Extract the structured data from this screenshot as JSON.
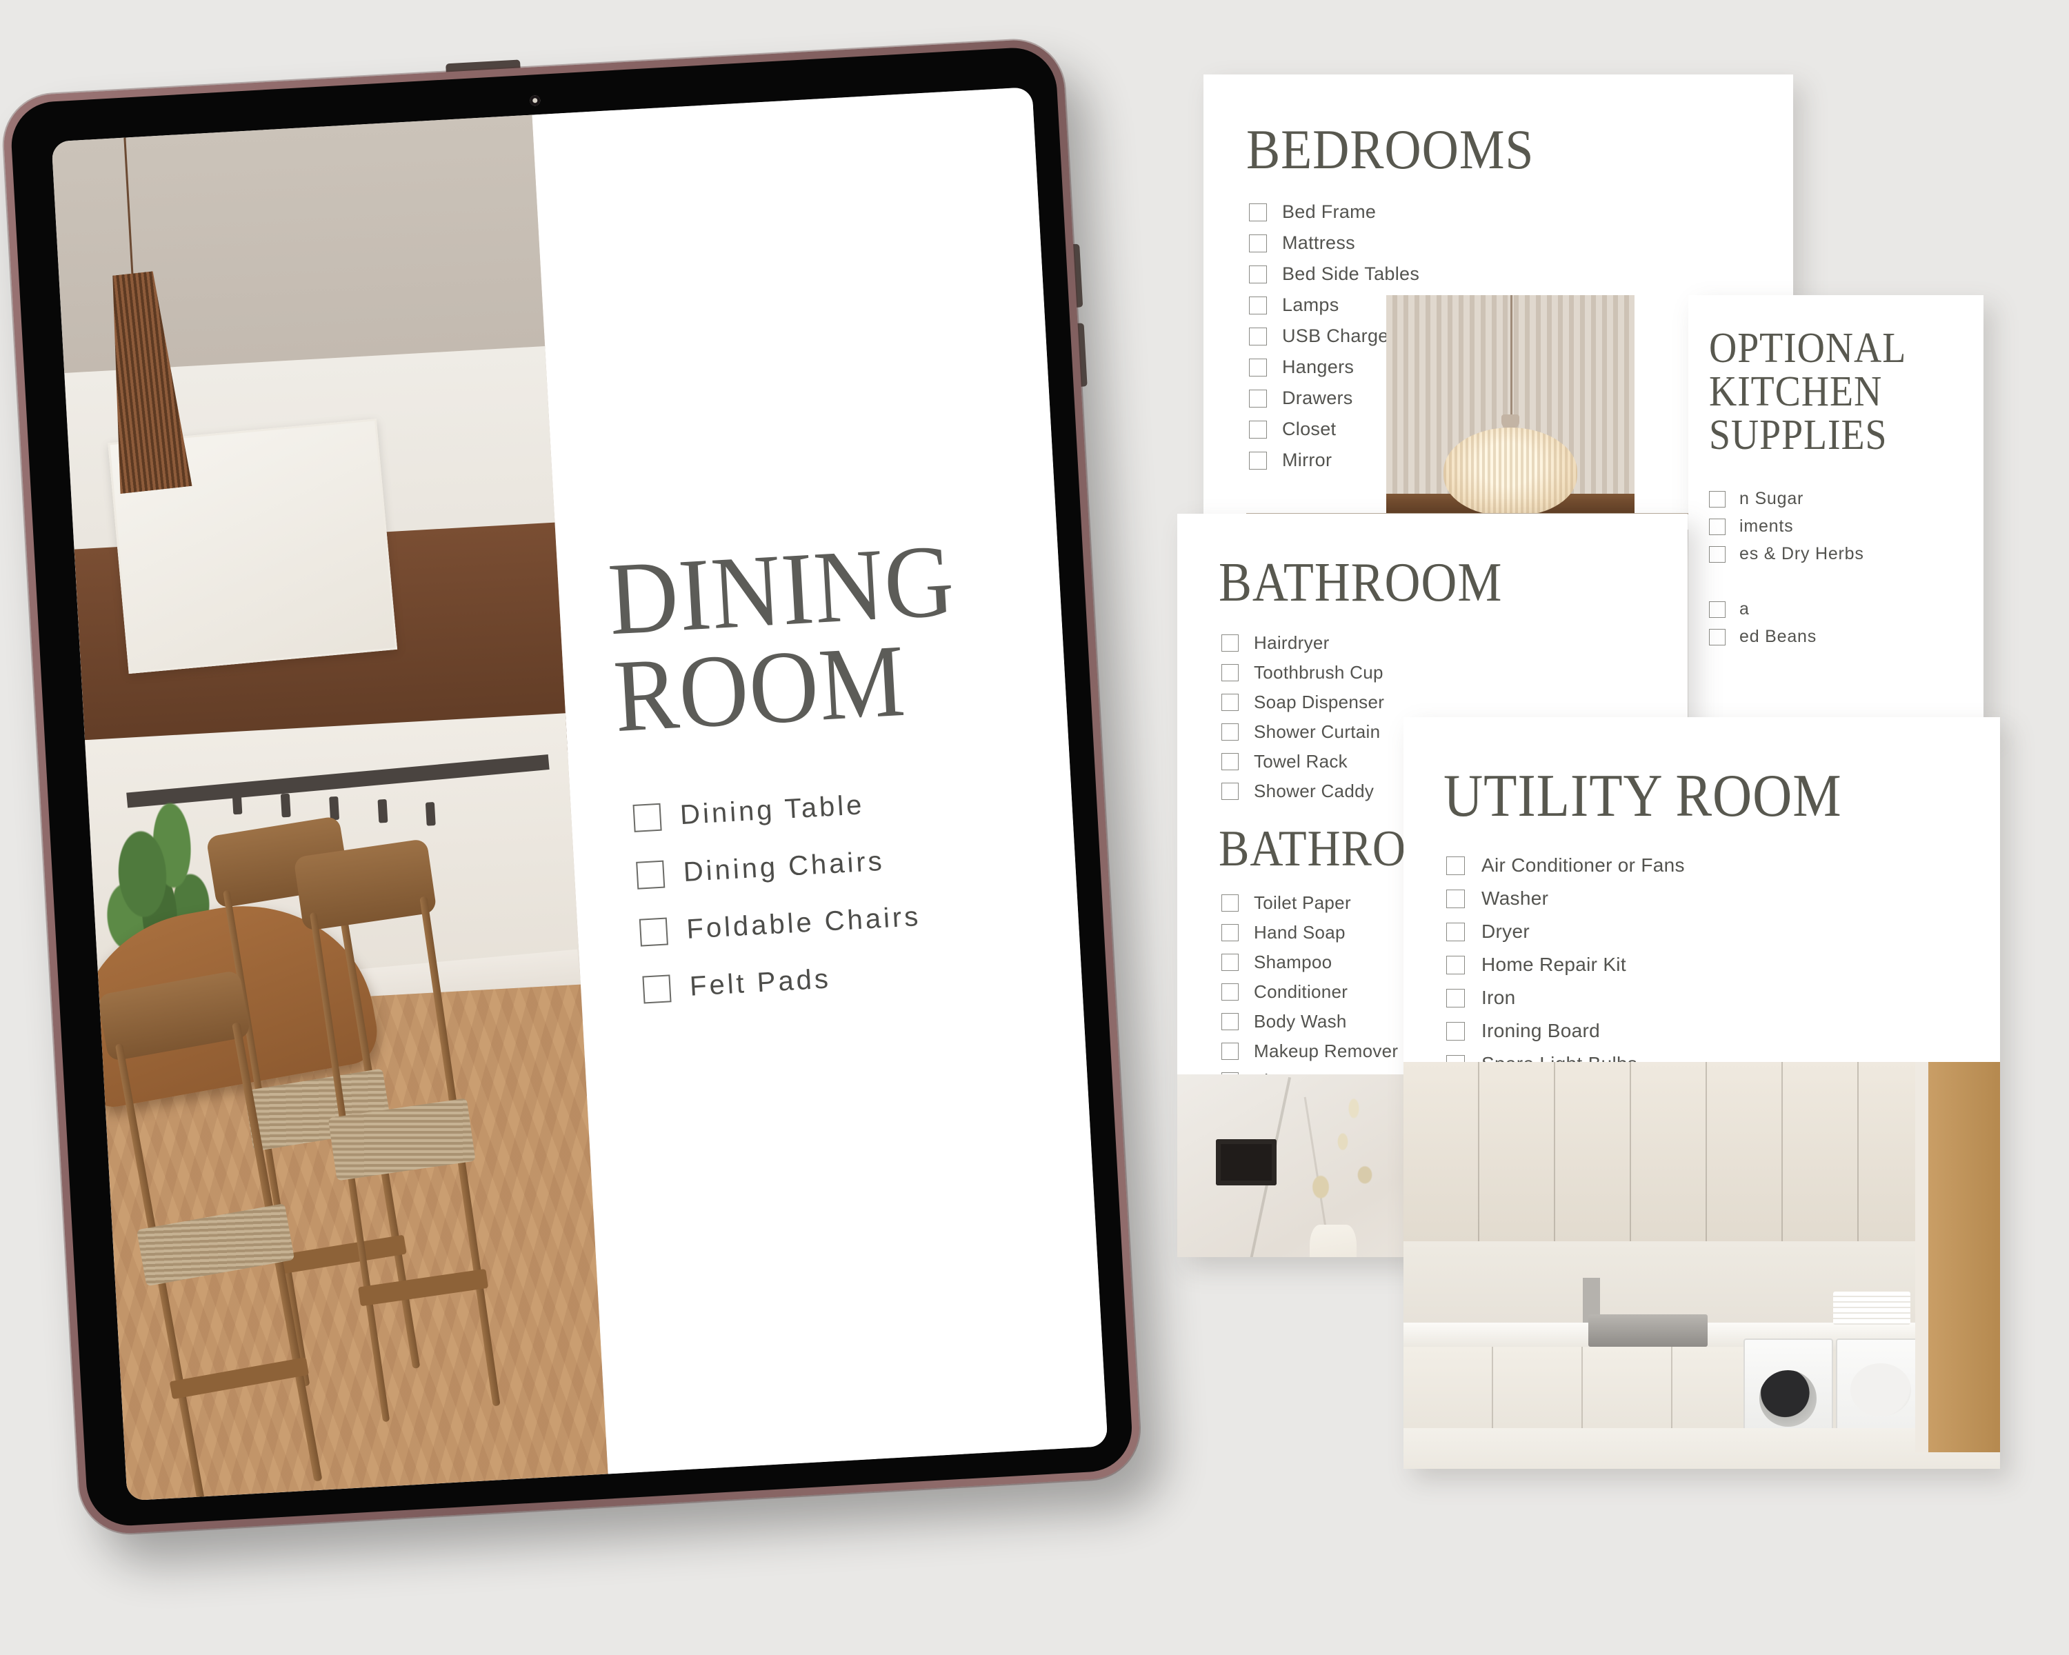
{
  "background_color": "#e9e8e6",
  "text_color": "#53534f",
  "title_color": "#58584f",
  "divider_color": "#b9ac9c",
  "tablet": {
    "frame_color": "#8a6565",
    "bezel_color": "#070707",
    "checklist": {
      "title": "DINING ROOM",
      "items": [
        "Dining Table",
        "Dining Chairs",
        "Foldable Chairs",
        "Felt Pads"
      ]
    },
    "photo_caption": "dining-room-interior-render"
  },
  "cards": {
    "bedrooms": {
      "title": "BEDROOMS",
      "items": [
        "Bed Frame",
        "Mattress",
        "Bed Side Tables",
        "Lamps",
        "USB Charger",
        "Hangers",
        "Drawers",
        "Closet",
        "Mirror"
      ],
      "photo_caption": "pendant-lamp-fluted-wall"
    },
    "optional_kitchen": {
      "title": "OPTIONAL KITCHEN SUPPLIES",
      "items": [
        "n Sugar",
        "iments",
        "es & Dry Herbs",
        "",
        "a",
        "ed Beans"
      ],
      "note": "card partially occluded; only trailing fragments of item labels are visible"
    },
    "bathroom": {
      "title": "BATHROOM",
      "items": [
        "Hairdryer",
        "Toothbrush Cup",
        "Soap Dispenser",
        "Shower Curtain",
        "Towel Rack",
        "Shower Caddy"
      ],
      "subtitle": "BATHROOM",
      "sub_items": [
        "Toilet Paper",
        "Hand Soap",
        "Shampoo",
        "Conditioner",
        "Body Wash",
        "Makeup Remover",
        "Tissues"
      ],
      "photo_caption": "bathroom-marble-vanity-vase"
    },
    "utility": {
      "title": "UTILITY ROOM",
      "items": [
        "Air Conditioner or Fans",
        "Washer",
        "Dryer",
        "Home Repair Kit",
        "Iron",
        "Ironing Board",
        "Spare Light Bulbs"
      ],
      "photo_caption": "utility-laundry-room-washer-dryer"
    }
  }
}
